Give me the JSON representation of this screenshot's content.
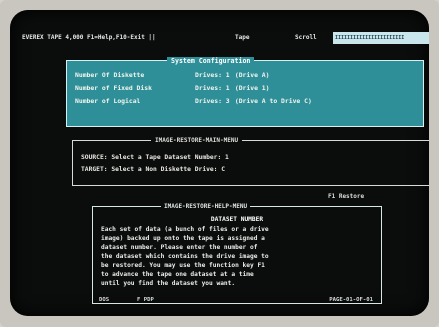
{
  "menubar": {
    "title": "EVEREX TAPE 4,000 F1=Help,F10-Exit  ||",
    "tape": "Tape",
    "scroll": "Scroll",
    "right_label": "IIIIIIIIIIIIIIIIIIIIIII"
  },
  "system_configuration": {
    "title": "System Configuration",
    "rows": [
      {
        "label": "Number Of Diskette",
        "count_label": "Drives: 1",
        "detail": "(Drive A)"
      },
      {
        "label": "Number of Fixed Disk",
        "count_label": "Drives: 1",
        "detail": "(Drive 1)"
      },
      {
        "label": "Number of Logical",
        "count_label": "Drives: 3",
        "detail": "(Drive A  to Drive C)"
      }
    ]
  },
  "restore": {
    "title": "IMAGE-RESTORE-MAIN-MENU",
    "source": "SOURCE: Select a Tape Dataset Number: 1",
    "target": "TARGET: Select a Non Diskette  Drive: C"
  },
  "f1_hint": "F1 Restore",
  "help": {
    "title": "IMAGE-RESTORE-HELP-MENU",
    "heading": "DATASET NUMBER",
    "lines": [
      "Each set of data (a bunch of files or a drive",
      "image) backed up onto the tape is assigned a",
      "dataset number.  Please enter the number of",
      "the dataset which contains the drive image to",
      "be restored.  You may use the function key F1",
      "to advance the  tape  one  dataset  at a time",
      "until you find the dataset you want."
    ],
    "footer_dos": "DOS",
    "footer_pgdn": "F PDP",
    "footer_page": "PAGE-01-OF-01"
  }
}
